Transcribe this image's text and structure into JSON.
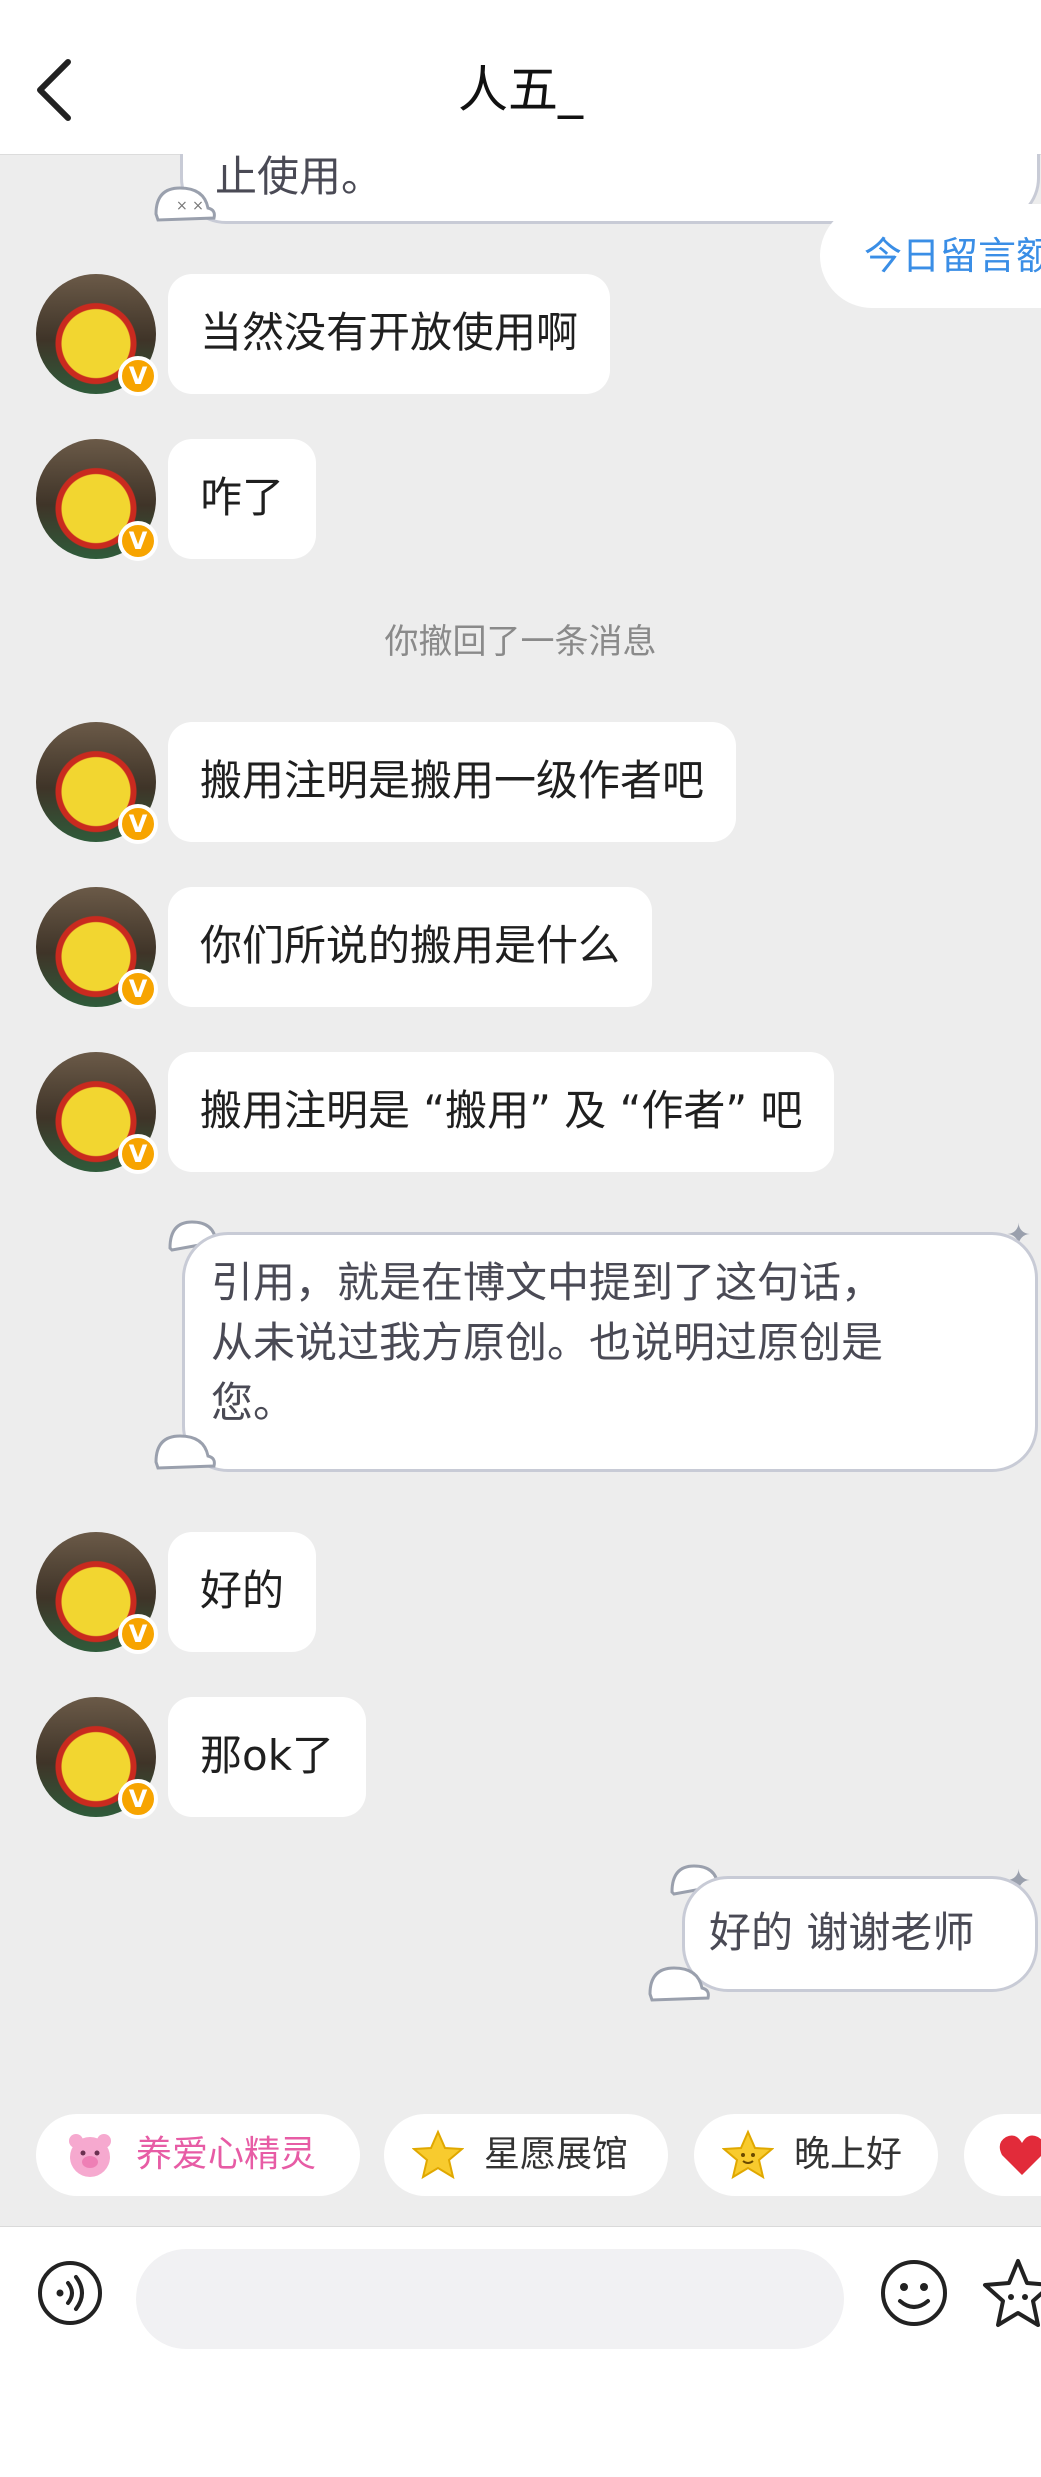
{
  "header": {
    "title": "人五_"
  },
  "messages": {
    "partial_top_out": "止使用。",
    "partial_top_right": "今日留言额",
    "m1": "当然没有开放使用啊",
    "m2": "咋了",
    "system_recalled": "你撤回了一条消息",
    "m3": "搬用注明是搬用一级作者吧",
    "m4": "你们所说的搬用是什么",
    "m5": "搬用注明是 “搬用” 及 “作者” 吧",
    "out1_lines": [
      "引用，就是在博文中提到了这句话，",
      "从未说过我方原创。也说明过原创是",
      "您。"
    ],
    "m6": "好的",
    "m7": "那ok了",
    "out2": "好的 谢谢老师"
  },
  "chips": [
    {
      "label": "养爱心精灵",
      "icon": "pig-sprite-icon",
      "color": "#e75ca5"
    },
    {
      "label": "星愿展馆",
      "icon": "star-icon",
      "color": "#333333"
    },
    {
      "label": "晚上好",
      "icon": "star-face-icon",
      "color": "#333333"
    },
    {
      "label": "",
      "icon": "heart-icon",
      "color": "#e22b3a"
    }
  ],
  "input": {
    "placeholder": ""
  },
  "colors": {
    "verified_badge": "#f7a400",
    "link_blue": "#3a8ee6",
    "chip_pink": "#e75ca5"
  }
}
